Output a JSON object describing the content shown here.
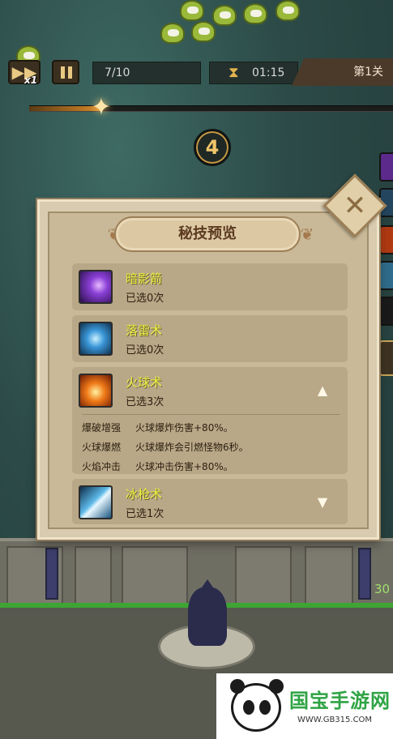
{
  "hud": {
    "speed_label": "x1",
    "wave_text": "7/10",
    "timer_text": "01:15",
    "level_text": "第1关",
    "countdown": "4",
    "wave_progress": 0.2
  },
  "dialog": {
    "title": "秘技预览"
  },
  "skills": [
    {
      "name": "暗影箭",
      "count": "已选0次",
      "icon": "shadow-arrow-icon",
      "color": "#6b2fb0"
    },
    {
      "name": "落雷术",
      "count": "已选0次",
      "icon": "lightning-icon",
      "color": "#2a7ab8"
    },
    {
      "name": "火球术",
      "count": "已选3次",
      "icon": "fireball-icon",
      "color": "#e0521a",
      "expanded_arrow": "▲",
      "details": [
        {
          "name": "爆破增强",
          "desc": "火球爆炸伤害+80%。"
        },
        {
          "name": "火球爆燃",
          "desc": "火球爆炸会引燃怪物6秒。"
        },
        {
          "name": "火焰冲击",
          "desc": "火球冲击伤害+80%。"
        }
      ]
    },
    {
      "name": "冰枪术",
      "count": "已选1次",
      "icon": "ice-spear-icon",
      "color": "#3d8fc4",
      "collapsed_arrow": "▼"
    }
  ],
  "scene": {
    "hp_text": "30"
  },
  "watermark": {
    "brand": "国宝手游网",
    "url": "WWW.GB315.COM"
  }
}
